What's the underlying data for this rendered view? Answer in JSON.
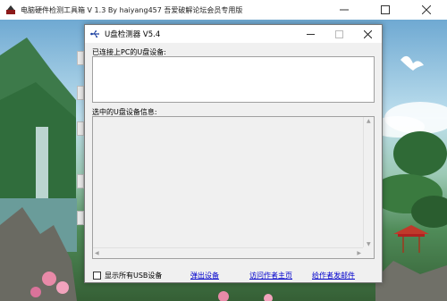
{
  "main_window": {
    "title": "电脑硬件检测工具箱 V 1.3   By haiyang457     吾爱破解论坛会员专用版",
    "buttons": {
      "minimize": "—",
      "maximize": "☐",
      "close": "✕"
    }
  },
  "dialog": {
    "title": "U盘检测器 V5.4",
    "buttons": {
      "minimize": "—",
      "maximize": "☐",
      "close": "✕"
    },
    "connected_label": "已连接上PC的U盘设备:",
    "selected_label": "选中的U盘设备信息:",
    "show_all_usb_label": "显示所有USB设备",
    "show_all_usb_checked": false,
    "eject_link": "弹出设备",
    "visit_author_link": "访问作者主页",
    "email_author_link": "给作者发邮件"
  },
  "colors": {
    "link": "#0000cc",
    "dialog_bg": "#f0f0f0",
    "titlebar_bg": "#ffffff"
  },
  "icons": {
    "app_icon": "hardware-tool-icon",
    "dialog_icon": "usb-icon"
  }
}
